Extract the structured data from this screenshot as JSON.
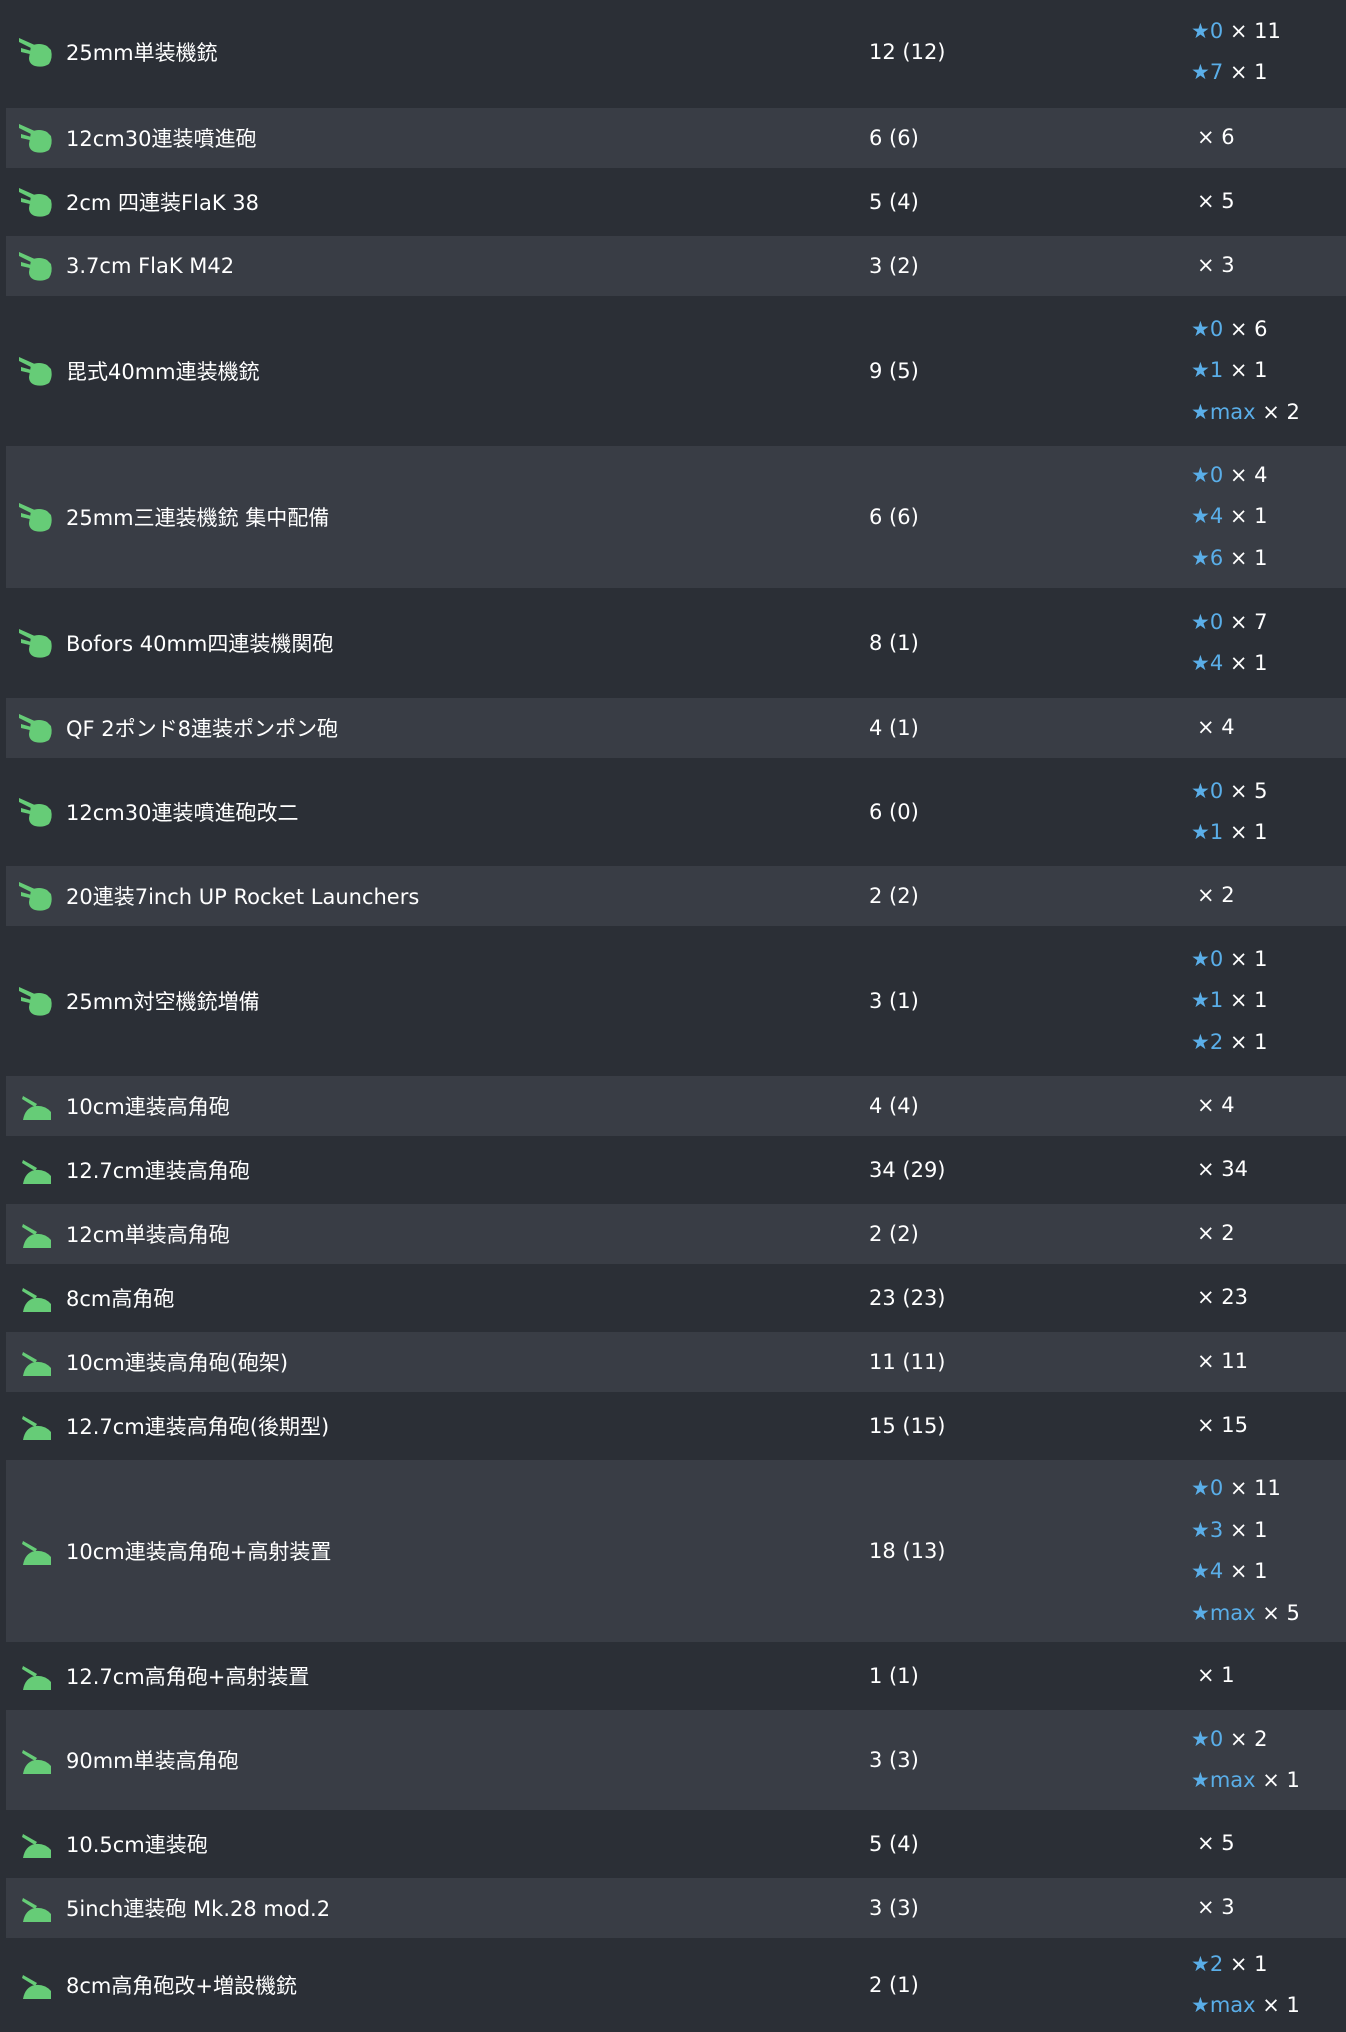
{
  "colors": {
    "row_dark": "#2b2f36",
    "row_light": "#393d45",
    "star_blue": "#5aaee8",
    "icon_green": "#66cc77"
  },
  "rows": [
    {
      "icon": "aa-gun-icon",
      "name": "25mm単装機銃",
      "count": "12 (12)",
      "stars": [
        {
          "level": "★0",
          "mult": "× 11"
        },
        {
          "level": "★7",
          "mult": "× 1"
        }
      ]
    },
    {
      "icon": "aa-gun-icon",
      "name": "12cm30連装噴進砲",
      "count": "6 (6)",
      "stars": [
        {
          "level": "",
          "mult": "× 6"
        }
      ]
    },
    {
      "icon": "aa-gun-icon",
      "name": "2cm 四連装FlaK 38",
      "count": "5 (4)",
      "stars": [
        {
          "level": "",
          "mult": "× 5"
        }
      ]
    },
    {
      "icon": "aa-gun-icon",
      "name": "3.7cm FlaK M42",
      "count": "3 (2)",
      "stars": [
        {
          "level": "",
          "mult": "× 3"
        }
      ]
    },
    {
      "icon": "aa-gun-icon",
      "name": "毘式40mm連装機銃",
      "count": "9 (5)",
      "stars": [
        {
          "level": "★0",
          "mult": "× 6"
        },
        {
          "level": "★1",
          "mult": "× 1"
        },
        {
          "level": "★max",
          "mult": "× 2"
        }
      ]
    },
    {
      "icon": "aa-gun-icon",
      "name": "25mm三連装機銃 集中配備",
      "count": "6 (6)",
      "stars": [
        {
          "level": "★0",
          "mult": "× 4"
        },
        {
          "level": "★4",
          "mult": "× 1"
        },
        {
          "level": "★6",
          "mult": "× 1"
        }
      ]
    },
    {
      "icon": "aa-gun-icon",
      "name": "Bofors 40mm四連装機関砲",
      "count": "8 (1)",
      "stars": [
        {
          "level": "★0",
          "mult": "× 7"
        },
        {
          "level": "★4",
          "mult": "× 1"
        }
      ]
    },
    {
      "icon": "aa-gun-icon",
      "name": "QF 2ポンド8連装ポンポン砲",
      "count": "4 (1)",
      "stars": [
        {
          "level": "",
          "mult": "× 4"
        }
      ]
    },
    {
      "icon": "aa-gun-icon",
      "name": "12cm30連装噴進砲改二",
      "count": "6 (0)",
      "stars": [
        {
          "level": "★0",
          "mult": "× 5"
        },
        {
          "level": "★1",
          "mult": "× 1"
        }
      ]
    },
    {
      "icon": "aa-gun-icon",
      "name": "20連装7inch UP Rocket Launchers",
      "count": "2 (2)",
      "stars": [
        {
          "level": "",
          "mult": "× 2"
        }
      ]
    },
    {
      "icon": "aa-gun-icon",
      "name": "25mm対空機銃増備",
      "count": "3 (1)",
      "stars": [
        {
          "level": "★0",
          "mult": "× 1"
        },
        {
          "level": "★1",
          "mult": "× 1"
        },
        {
          "level": "★2",
          "mult": "× 1"
        }
      ]
    },
    {
      "icon": "ha-gun-icon",
      "name": "10cm連装高角砲",
      "count": "4 (4)",
      "stars": [
        {
          "level": "",
          "mult": "× 4"
        }
      ]
    },
    {
      "icon": "ha-gun-icon",
      "name": "12.7cm連装高角砲",
      "count": "34 (29)",
      "stars": [
        {
          "level": "",
          "mult": "× 34"
        }
      ]
    },
    {
      "icon": "ha-gun-icon",
      "name": "12cm単装高角砲",
      "count": "2 (2)",
      "stars": [
        {
          "level": "",
          "mult": "× 2"
        }
      ]
    },
    {
      "icon": "ha-gun-icon",
      "name": "8cm高角砲",
      "count": "23 (23)",
      "stars": [
        {
          "level": "",
          "mult": "× 23"
        }
      ]
    },
    {
      "icon": "ha-gun-icon",
      "name": "10cm連装高角砲(砲架)",
      "count": "11 (11)",
      "stars": [
        {
          "level": "",
          "mult": "× 11"
        }
      ]
    },
    {
      "icon": "ha-gun-icon",
      "name": "12.7cm連装高角砲(後期型)",
      "count": "15 (15)",
      "stars": [
        {
          "level": "",
          "mult": "× 15"
        }
      ]
    },
    {
      "icon": "ha-gun-icon",
      "name": "10cm連装高角砲+高射装置",
      "count": "18 (13)",
      "stars": [
        {
          "level": "★0",
          "mult": "× 11"
        },
        {
          "level": "★3",
          "mult": "× 1"
        },
        {
          "level": "★4",
          "mult": "× 1"
        },
        {
          "level": "★max",
          "mult": "× 5"
        }
      ]
    },
    {
      "icon": "ha-gun-icon",
      "name": "12.7cm高角砲+高射装置",
      "count": "1 (1)",
      "stars": [
        {
          "level": "",
          "mult": "× 1"
        }
      ]
    },
    {
      "icon": "ha-gun-icon",
      "name": "90mm単装高角砲",
      "count": "3 (3)",
      "stars": [
        {
          "level": "★0",
          "mult": "× 2"
        },
        {
          "level": "★max",
          "mult": "× 1"
        }
      ]
    },
    {
      "icon": "ha-gun-icon",
      "name": "10.5cm連装砲",
      "count": "5 (4)",
      "stars": [
        {
          "level": "",
          "mult": "× 5"
        }
      ]
    },
    {
      "icon": "ha-gun-icon",
      "name": "5inch連装砲 Mk.28 mod.2",
      "count": "3 (3)",
      "stars": [
        {
          "level": "",
          "mult": "× 3"
        }
      ]
    },
    {
      "icon": "ha-gun-icon",
      "name": "8cm高角砲改+増設機銃",
      "count": "2 (1)",
      "stars": [
        {
          "level": "★2",
          "mult": "× 1"
        },
        {
          "level": "★max",
          "mult": "× 1"
        }
      ]
    }
  ]
}
